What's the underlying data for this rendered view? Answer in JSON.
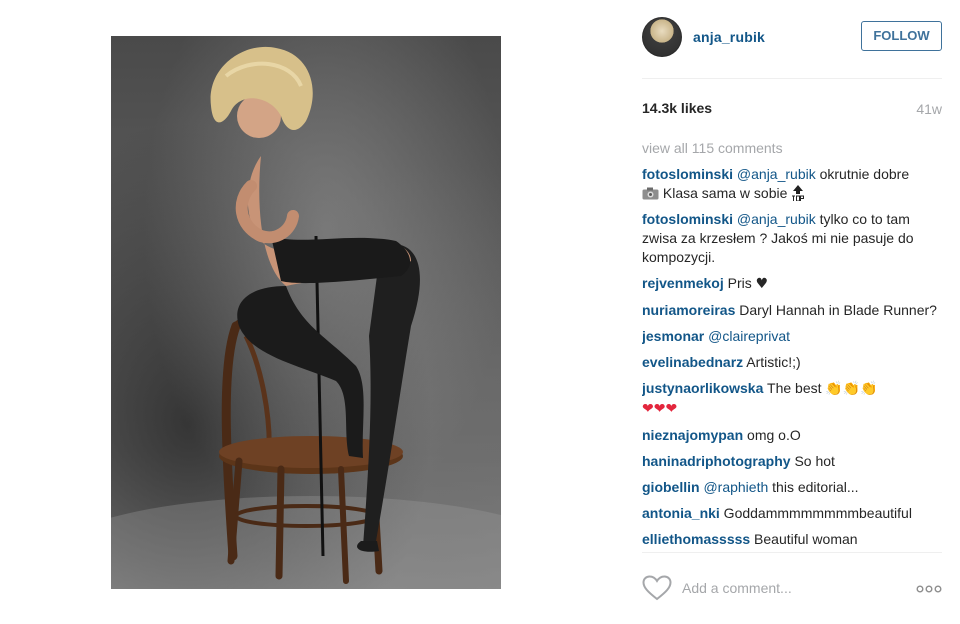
{
  "post": {
    "photo_alt_icon": "photo-icon",
    "username": "anja_rubik",
    "follow_label": "FOLLOW",
    "likes": "14.3k likes",
    "age": "41w"
  },
  "comments": {
    "view_all": "view all 115 comments",
    "items": [
      {
        "user": "fotoslominski",
        "mention": "@anja_rubik",
        "text": " okrutnie dobre",
        "tail": " Klasa sama w sobie ",
        "icons": [
          "camera-icon",
          "top-icon"
        ]
      },
      {
        "user": "fotoslominski",
        "mention": "@anja_rubik",
        "text": " tylko co to tam zwisa za krzesłem ? Jakoś mi nie pasuje do kompozycji."
      },
      {
        "user": "rejvenmekoj",
        "text": " Pris ",
        "emoji": "♥"
      },
      {
        "user": "nuriamoreiras",
        "text": " Daryl Hannah in Blade Runner?"
      },
      {
        "user": "jesmonar",
        "mention": "@claireprivat",
        "text": ""
      },
      {
        "user": "evelinabednarz",
        "text": " Artistic!;)"
      },
      {
        "user": "justynaorlikowska",
        "text": " The best ",
        "emoji": "👏👏👏",
        "emoji2": "❤❤❤"
      },
      {
        "user": "nieznajomypan",
        "text": " omg o.O"
      },
      {
        "user": "haninadriphotography",
        "text": " So hot"
      },
      {
        "user": "giobellin",
        "mention": "@raphieth",
        "text": " this editorial..."
      },
      {
        "user": "antonia_nki",
        "text": " Goddammmmmmmmbeautiful"
      },
      {
        "user": "elliethomasssss",
        "text": " Beautiful woman"
      }
    ]
  },
  "comment_bar": {
    "placeholder": "Add a comment...",
    "like_icon": "heart-outline-icon",
    "more_icon": "more-options-icon"
  },
  "colors": {
    "link": "#125688",
    "follow": "#3f729b",
    "muted": "#a5a7aa",
    "text": "#262626"
  }
}
